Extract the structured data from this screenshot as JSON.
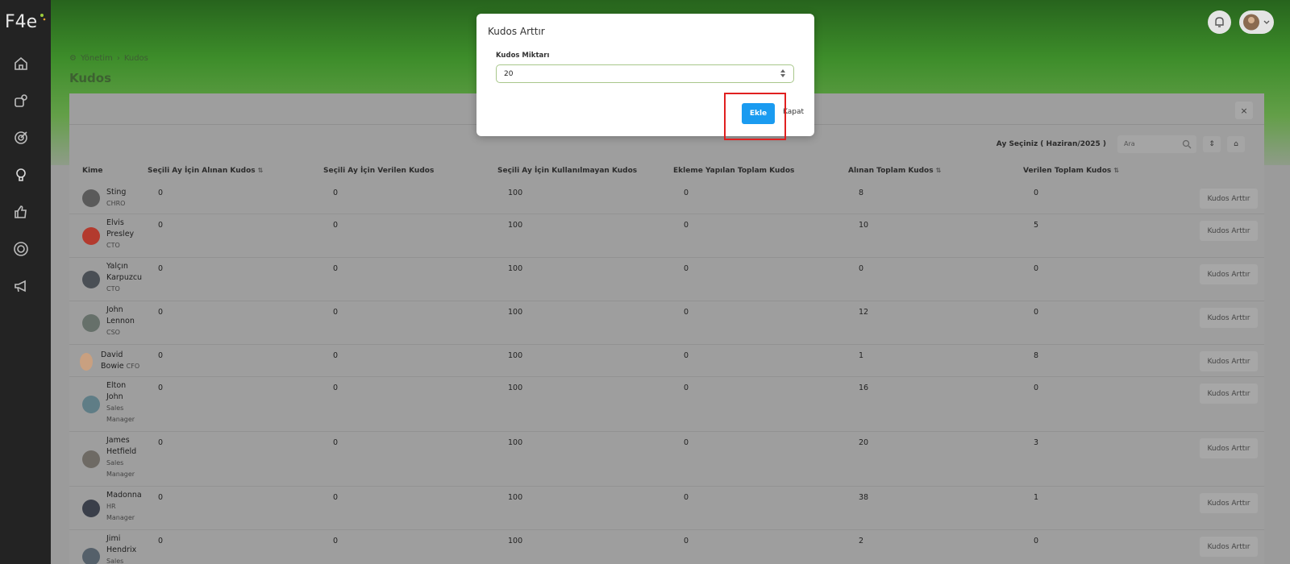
{
  "breadcrumb": {
    "section": "Yönetim",
    "current": "Kudos"
  },
  "page_title": "Kudos",
  "toolbar": {
    "month_label": "Ay Seçiniz ( Haziran/2025 )",
    "search_placeholder": "Ara",
    "tool1": "⇕",
    "tool2": "⌂",
    "close": "×"
  },
  "columns": [
    "Kime",
    "Seçili Ay İçin Alınan Kudos",
    "Seçili Ay İçin Verilen Kudos",
    "Seçili Ay İçin Kullanılmayan Kudos",
    "Ekleme Yapılan Toplam Kudos",
    "Alınan Toplam Kudos",
    "Verilen Toplam Kudos"
  ],
  "rows": [
    {
      "name": "Sting",
      "role": "CHRO",
      "c1": "0",
      "c2": "0",
      "c3": "100",
      "c4": "0",
      "c5": "8",
      "c6": "0",
      "action": "Kudos Arttır"
    },
    {
      "name": "Elvis\nPresley",
      "role": "CTO",
      "c1": "0",
      "c2": "0",
      "c3": "100",
      "c4": "0",
      "c5": "10",
      "c6": "5",
      "action": "Kudos Arttır"
    },
    {
      "name": "Yalçın\nKarpuzcu",
      "role": "CTO",
      "c1": "0",
      "c2": "0",
      "c3": "100",
      "c4": "0",
      "c5": "0",
      "c6": "0",
      "action": "Kudos Arttır"
    },
    {
      "name": "John\nLennon",
      "role": "CSO",
      "c1": "0",
      "c2": "0",
      "c3": "100",
      "c4": "0",
      "c5": "12",
      "c6": "0",
      "action": "Kudos Arttır"
    },
    {
      "name": "David\nBowie",
      "role": "CFO",
      "c1": "0",
      "c2": "0",
      "c3": "100",
      "c4": "0",
      "c5": "1",
      "c6": "8",
      "action": "Kudos Arttır"
    },
    {
      "name": "Elton\nJohn",
      "role": "Sales\nManager",
      "c1": "0",
      "c2": "0",
      "c3": "100",
      "c4": "0",
      "c5": "16",
      "c6": "0",
      "action": "Kudos Arttır"
    },
    {
      "name": "James\nHetfield",
      "role": "Sales\nManager",
      "c1": "0",
      "c2": "0",
      "c3": "100",
      "c4": "0",
      "c5": "20",
      "c6": "3",
      "action": "Kudos Arttır"
    },
    {
      "name": "Madonna",
      "role": "HR\nManager",
      "c1": "0",
      "c2": "0",
      "c3": "100",
      "c4": "0",
      "c5": "38",
      "c6": "1",
      "action": "Kudos Arttır"
    },
    {
      "name": "Jimi\nHendrix",
      "role": "Sales",
      "c1": "0",
      "c2": "0",
      "c3": "100",
      "c4": "0",
      "c5": "2",
      "c6": "0",
      "action": "Kudos Arttır"
    }
  ],
  "modal": {
    "title": "Kudos Arttır",
    "field_label": "Kudos Miktarı",
    "field_value": "20",
    "submit": "Ekle",
    "close": "Kapat"
  }
}
